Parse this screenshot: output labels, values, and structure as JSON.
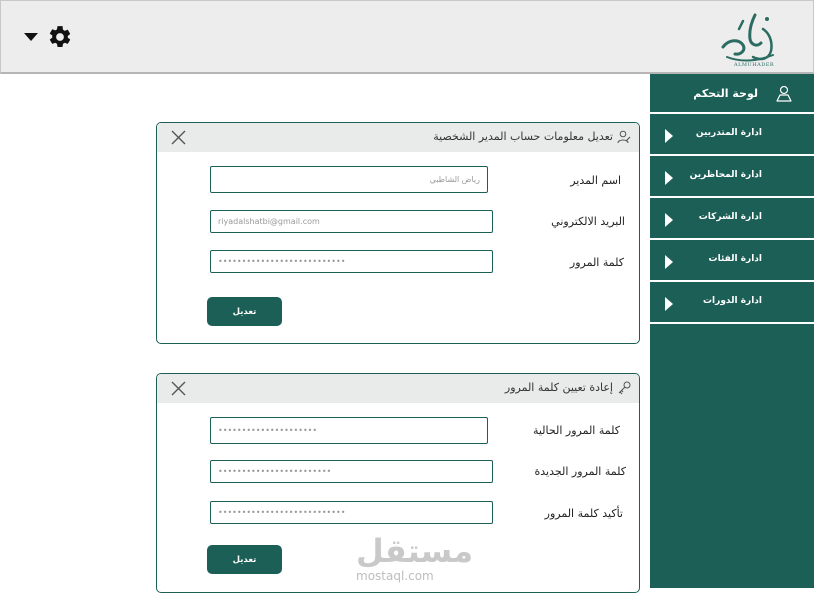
{
  "topbar": {
    "logo_text": "ALMUHADER"
  },
  "sidebar": {
    "header": "لوحة التحكم",
    "items": [
      {
        "label": "ادارة المتدربين"
      },
      {
        "label": "ادارة المحاظرين"
      },
      {
        "label": "ادارة الشركات"
      },
      {
        "label": "ادارة الفئات"
      },
      {
        "label": "ادارة الدورات"
      }
    ]
  },
  "account_panel": {
    "title": "تعديل معلومات حساب المدير الشخصية",
    "fields": [
      {
        "label": "اسم المدير",
        "value": "رياض الشاطبي"
      },
      {
        "label": "البريد الالكتروني",
        "value": "riyadalshatbi@gmail.com"
      },
      {
        "label": "كلمة المرور",
        "value": "•••••••••••••••••••••••••••"
      }
    ],
    "submit_label": "تعديل"
  },
  "password_panel": {
    "title": "إعادة تعيين كلمة المرور",
    "fields": [
      {
        "label": "كلمة المرور الحالية",
        "value": "•••••••••••••••••••••"
      },
      {
        "label": "كلمة المرور الجديدة",
        "value": "••••••••••••••••••••••••"
      },
      {
        "label": "تأكيد كلمة المرور",
        "value": "•••••••••••••••••••••••••••"
      }
    ],
    "submit_label": "تعديل"
  },
  "watermark": {
    "main": "مستقل",
    "sub": "mostaql.com"
  },
  "colors": {
    "brand": "#1c5f57",
    "topbar_bg": "#ededed",
    "panel_head_bg": "#e9ebea"
  }
}
